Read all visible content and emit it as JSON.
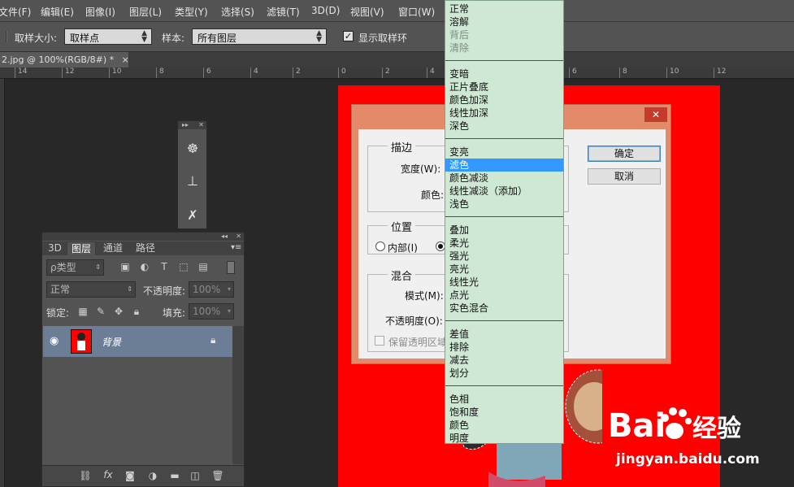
{
  "menubar": {
    "items": [
      "文件(F)",
      "编辑(E)",
      "图像(I)",
      "图层(L)",
      "类型(Y)",
      "选择(S)",
      "滤镜(T)",
      "3D(D)",
      "视图(V)",
      "窗口(W)"
    ]
  },
  "options": {
    "sample_size_label": "取样大小:",
    "sample_size_value": "取样点",
    "sample_label": "样本:",
    "sample_value": "所有图层",
    "show_ring_label": "显示取样环",
    "show_ring_checked": true
  },
  "document": {
    "tab_title": "2.jpg @ 100%(RGB/8#) *",
    "tab_close": "×"
  },
  "ruler": {
    "labels": [
      "14",
      "12",
      "10",
      "8",
      "6",
      "4",
      "2",
      "0",
      "2",
      "4",
      "6",
      "8",
      "10",
      "12"
    ]
  },
  "dialog": {
    "close": "✕",
    "stroke_group": "描边",
    "width_label": "宽度(W):",
    "color_label": "颜色:",
    "position_group": "位置",
    "inside_label": "内部(I)",
    "blend_group": "混合",
    "mode_label": "模式(M):",
    "opacity_label": "不透明度(O):",
    "preserve_label": "保留透明区域",
    "ok_button": "确定",
    "cancel_button": "取消"
  },
  "blend_modes": {
    "groups": [
      [
        {
          "label": "正常"
        },
        {
          "label": "溶解"
        },
        {
          "label": "背后",
          "disabled": true
        },
        {
          "label": "清除",
          "disabled": true
        }
      ],
      [
        {
          "label": "变暗"
        },
        {
          "label": "正片叠底"
        },
        {
          "label": "颜色加深"
        },
        {
          "label": "线性加深"
        },
        {
          "label": "深色"
        }
      ],
      [
        {
          "label": "变亮"
        },
        {
          "label": "滤色",
          "selected": true
        },
        {
          "label": "颜色减淡"
        },
        {
          "label": "线性减淡（添加）"
        },
        {
          "label": "浅色"
        }
      ],
      [
        {
          "label": "叠加"
        },
        {
          "label": "柔光"
        },
        {
          "label": "强光"
        },
        {
          "label": "亮光"
        },
        {
          "label": "线性光"
        },
        {
          "label": "点光"
        },
        {
          "label": "实色混合"
        }
      ],
      [
        {
          "label": "差值"
        },
        {
          "label": "排除"
        },
        {
          "label": "减去"
        },
        {
          "label": "划分"
        }
      ],
      [
        {
          "label": "色相"
        },
        {
          "label": "饱和度"
        },
        {
          "label": "颜色"
        },
        {
          "label": "明度"
        }
      ]
    ]
  },
  "tools_panel": {
    "collapse": "▸▸",
    "close": "✕"
  },
  "layers_panel": {
    "collapse": "◂◂",
    "close": "✕",
    "tabs": [
      "3D",
      "图层",
      "通道",
      "路径"
    ],
    "active_tab": "图层",
    "filter_value": "ρ类型",
    "mode_value": "正常",
    "opacity_label": "不透明度:",
    "opacity_value": "100%",
    "lock_label": "锁定:",
    "fill_label": "填充:",
    "fill_value": "100%",
    "layer_name": "背景",
    "footer_icons": [
      "link-icon",
      "fx-icon",
      "mask-icon",
      "adjustment-icon",
      "folder-icon",
      "new-layer-icon",
      "trash-icon"
    ],
    "fx_text": "fx"
  },
  "watermark": {
    "brand": "Bai",
    "brand2": "经验",
    "url": "jingyan.baidu.com"
  },
  "colors": {
    "canvas_bg": "#ff0000",
    "dropdown_bg": "#cfe8d4",
    "dropdown_selected": "#3399ff",
    "dialog_frame": "#e38a6a",
    "layer_selected": "#6b7e96"
  }
}
